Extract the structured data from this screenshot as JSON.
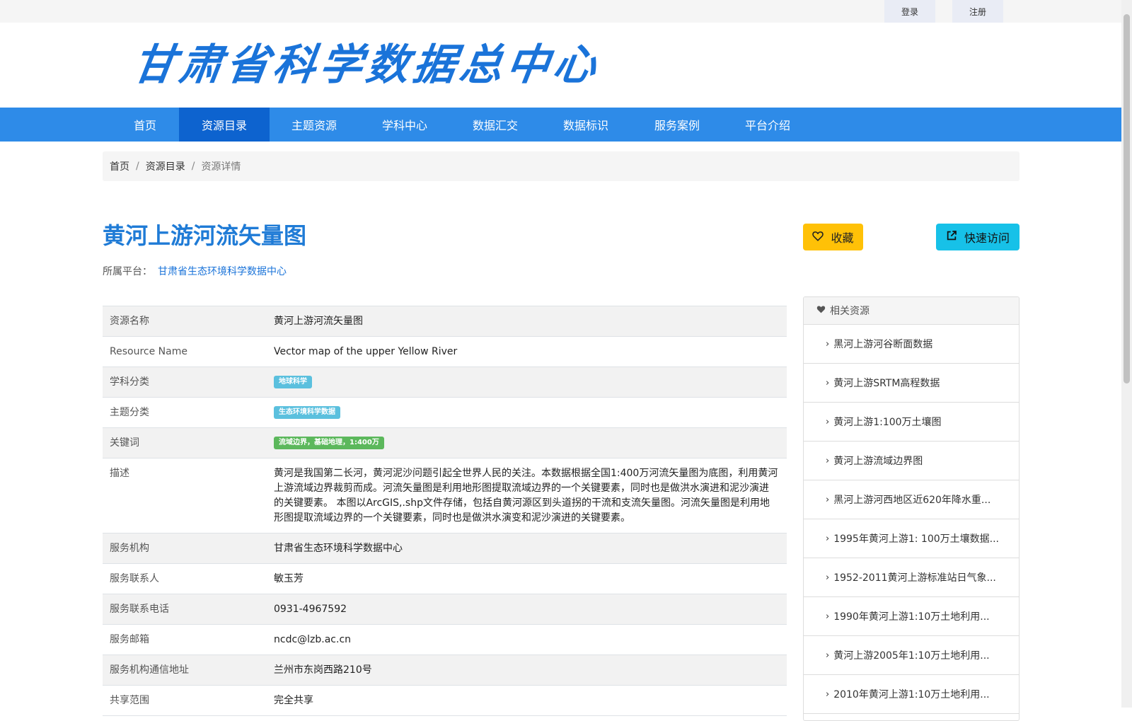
{
  "topbar": {
    "login": "登录",
    "register": "注册"
  },
  "logo": {
    "text": "甘肃省科学数据总中心"
  },
  "nav": {
    "items": [
      "首页",
      "资源目录",
      "主题资源",
      "学科中心",
      "数据汇交",
      "数据标识",
      "服务案例",
      "平台介绍"
    ],
    "active": "资源目录"
  },
  "breadcrumb": {
    "home": "首页",
    "catalog": "资源目录",
    "current": "资源详情"
  },
  "title": "黄河上游河流矢量图",
  "platform": {
    "label": "所属平台：",
    "name": "甘肃省生态环境科学数据中心"
  },
  "actions": {
    "favorite": "收藏",
    "quick_visit": "快速访问"
  },
  "info": {
    "resource_name_label": "资源名称",
    "resource_name": "黄河上游河流矢量图",
    "resource_name_en_label": "Resource Name",
    "resource_name_en": "Vector map of the upper Yellow River",
    "discipline_label": "学科分类",
    "discipline": "地球科学",
    "theme_label": "主题分类",
    "theme": "生态环境科学数据",
    "keywords_label": "关键词",
    "keywords": "流域边界，基础地理，1:400万",
    "description_label": "描述",
    "description": "黄河是我国第二长河，黄河泥沙问题引起全世界人民的关注。本数据根据全国1:400万河流矢量图为底图，利用黄河上游流域边界裁剪而成。河流矢量图是利用地形图提取流域边界的一个关键要素，同时也是做洪水演进和泥沙演进的关键要素。 本图以ArcGIS,.shp文件存储，包括自黄河源区到头道拐的干流和支流矢量图。河流矢量图是利用地形图提取流域边界的一个关键要素，同时也是做洪水演变和泥沙演进的关键要素。",
    "org_label": "服务机构",
    "org": "甘肃省生态环境科学数据中心",
    "contact_label": "服务联系人",
    "contact": "敏玉芳",
    "phone_label": "服务联系电话",
    "phone": "0931-4967592",
    "email_label": "服务邮箱",
    "email": "ncdc@lzb.ac.cn",
    "address_label": "服务机构通信地址",
    "address": "兰州市东岗西路210号",
    "share_label": "共享范围",
    "share": "完全共享"
  },
  "related": {
    "title": "相关资源",
    "items": [
      "黑河上游河谷断面数据",
      "黄河上游SRTM高程数据",
      "黄河上游1:100万土壤图",
      "黄河上游流域边界图",
      "黑河上游河西地区近620年降水重...",
      "1995年黄河上游1: 100万土壤数据...",
      "1952-2011黄河上游标准站日气象...",
      "1990年黄河上游1:10万土地利用...",
      "黄河上游2005年1:10万土地利用...",
      "2010年黄河上游1:10万土地利用..."
    ]
  },
  "colors": {
    "nav": "#2e8be8",
    "nav_active": "#0d63cf",
    "title": "#1f7bd6",
    "favorite": "#ffc107",
    "visit": "#17c1e8"
  }
}
